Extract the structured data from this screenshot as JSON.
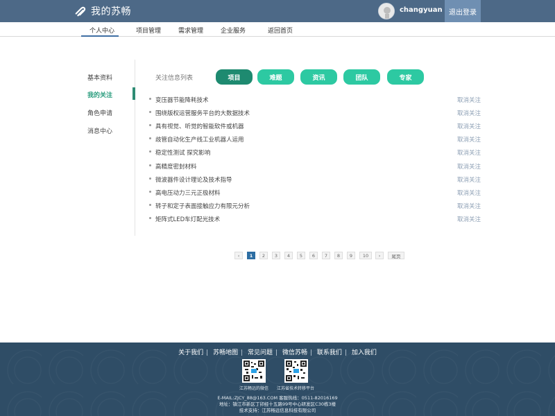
{
  "header": {
    "logo_text": "我的苏畅",
    "username": "changyuan",
    "logout_label": "退出登录"
  },
  "nav": {
    "items": [
      "个人中心",
      "项目管理",
      "需求管理",
      "企业服务",
      "返回首页"
    ],
    "active_index": 0
  },
  "sidebar": {
    "items": [
      "基本资料",
      "我的关注",
      "角色申请",
      "消息中心"
    ],
    "active_index": 1
  },
  "tabs": {
    "label": "关注信息列表",
    "items": [
      "项目",
      "难题",
      "资讯",
      "团队",
      "专家"
    ],
    "selected_index": 0
  },
  "list": {
    "action_label": "取消关注",
    "rows": [
      "变压器节能降耗技术",
      "围绕版权运营服务平台的大数据技术",
      "具有视觉、听觉的智能软件或机器",
      "歧管自动化生产线工业机器人运用",
      "稳定性测试 探究影响",
      "高精度密封材料",
      "微波器件设计理论及技术指导",
      "高电压动力三元正极材料",
      "转子和定子表面接触应力有限元分析",
      "矩阵式LED车灯配光技术"
    ]
  },
  "pagination": {
    "prev": "‹",
    "pages": [
      "1",
      "2",
      "3",
      "4",
      "5",
      "6",
      "7",
      "8",
      "9",
      "10"
    ],
    "current": "1",
    "next": "›",
    "last_label": "尾页"
  },
  "footer": {
    "links": [
      "关于我们",
      "苏畅地图",
      "常见问题",
      "微信苏畅",
      "联系我们",
      "加入我们"
    ],
    "qr_captions": [
      "江苏畅远的微信",
      "江苏省技术转移平台"
    ],
    "contact": "E-MAIL:ZJCY_88@163.COM   客服热线：0511-82016169",
    "address": "地址：镇江市新区丁卯经十五路99号中心研发区C30栋3楼",
    "support": "技术支持：江苏畅远信息科技有限公司"
  },
  "colors": {
    "header_bg": "#4d6987",
    "accent_green": "#2dc9a2",
    "selected_green": "#1e8a70",
    "footer_bg": "#2f4d66"
  }
}
